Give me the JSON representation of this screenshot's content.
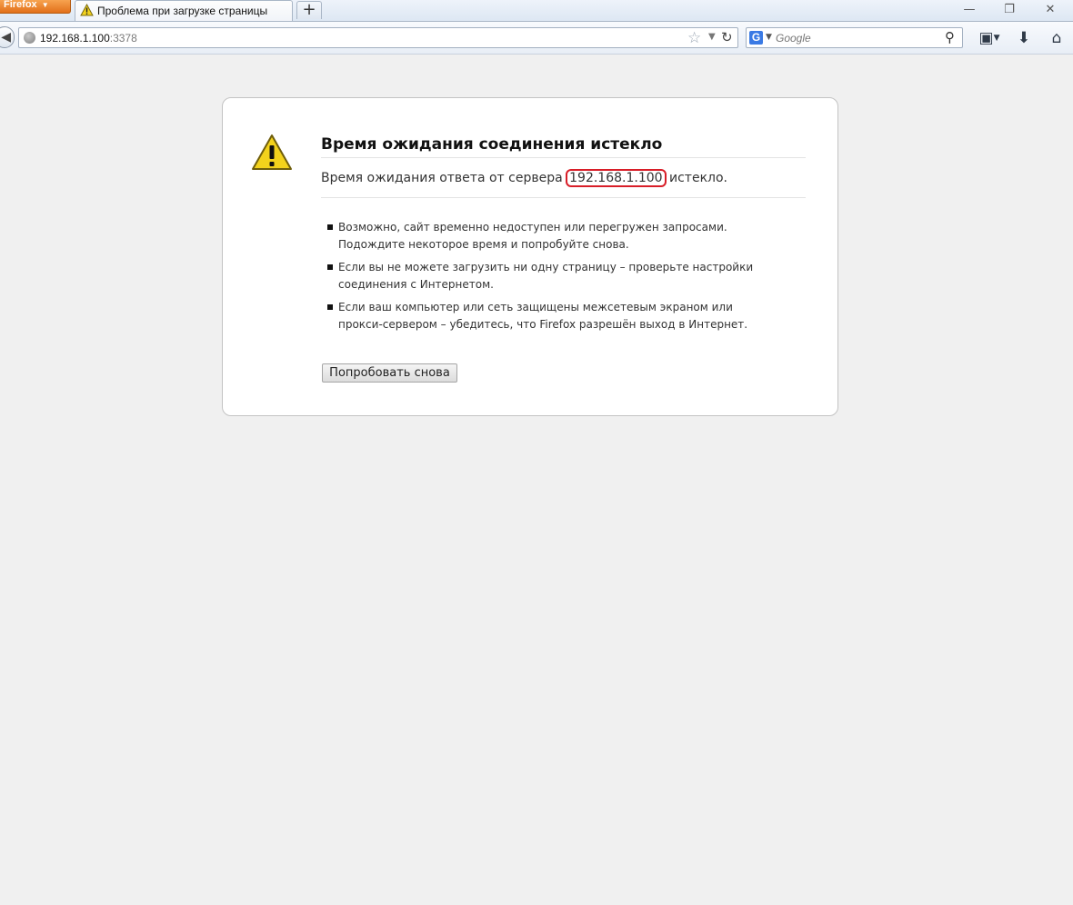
{
  "browser": {
    "app_button_label": "Firefox",
    "tab_title": "Проблема при загрузке страницы",
    "new_tab_label": "+",
    "window_controls": {
      "minimize": "—",
      "restore": "❐",
      "close": "✕"
    }
  },
  "navbar": {
    "url_host": "192.168.1.100",
    "url_port": ":3378",
    "search_placeholder": "Google",
    "search_engine_icon": "G"
  },
  "error": {
    "title": "Время ожидания соединения истекло",
    "desc_prefix": "Время ожидания ответа от сервера ",
    "server": "192.168.1.100",
    "desc_suffix": " истекло.",
    "tips": [
      "Возможно, сайт временно недоступен или перегружен запросами. Подождите некоторое время и попробуйте снова.",
      "Если вы не можете загрузить ни одну страницу – проверьте настройки соединения с Интернетом.",
      "Если ваш компьютер или сеть защищены межсетевым экраном или прокси-сервером – убедитесь, что Firefox разрешён выход в Интернет."
    ],
    "retry_label": "Попробовать снова"
  },
  "colors": {
    "highlight_border": "#d81e28",
    "firefox_orange": "#e2701a",
    "warning_yellow": "#f3d21c"
  }
}
